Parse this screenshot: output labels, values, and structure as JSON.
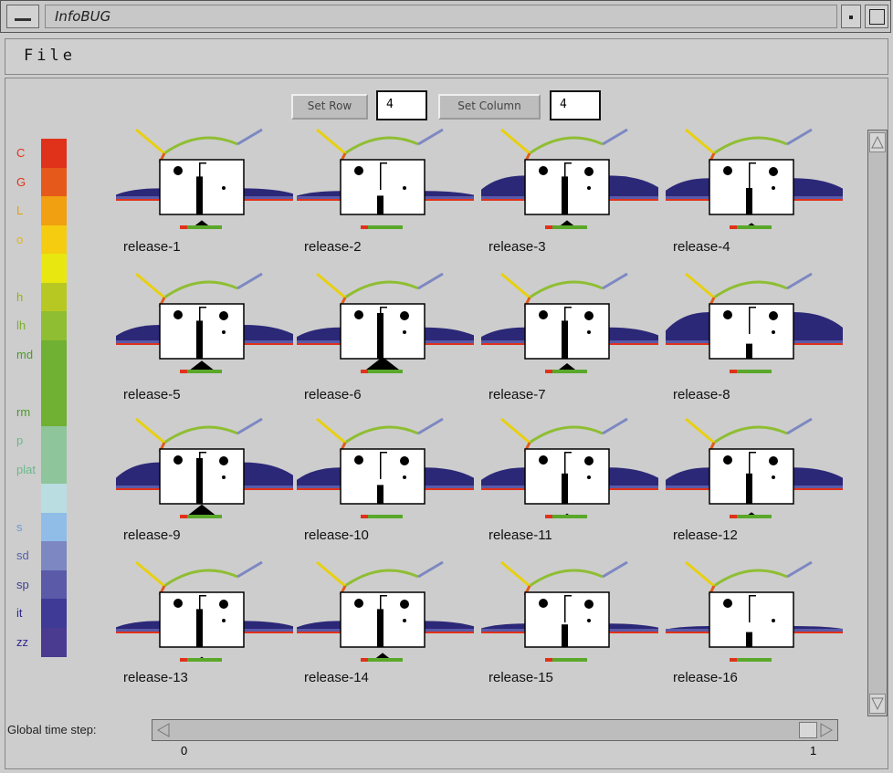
{
  "window": {
    "title": "InfoBUG",
    "menu_icon": "window-menu-icon",
    "minimize_icon": "minimize-icon",
    "maximize_icon": "maximize-icon"
  },
  "menubar": {
    "file_label": "File"
  },
  "controls": {
    "set_row_label": "Set Row",
    "row_value": "4",
    "set_column_label": "Set Column",
    "column_value": "4"
  },
  "legend": {
    "items": [
      {
        "label": "C",
        "color": "#e0321a",
        "label_color": "#e0321a"
      },
      {
        "label": "G",
        "color": "#e5591a",
        "label_color": "#e0321a"
      },
      {
        "label": "L",
        "color": "#f0a010",
        "label_color": "#e6a000"
      },
      {
        "label": "o",
        "color": "#f5cc10",
        "label_color": "#e6b800"
      },
      {
        "label": "",
        "color": "#e8e810",
        "label_color": "#cfcf00"
      },
      {
        "label": "h",
        "color": "#b8c822",
        "label_color": "#9ab000"
      },
      {
        "label": "lh",
        "color": "#8fbe32",
        "label_color": "#7ab02a"
      },
      {
        "label": "md",
        "color": "#70b032",
        "label_color": "#4a9a2a"
      },
      {
        "label": "",
        "color": "#70b032",
        "label_color": "#4a9a2a"
      },
      {
        "label": "rm",
        "color": "#70b032",
        "label_color": "#4a9a2a"
      },
      {
        "label": "p",
        "color": "#8ec59a",
        "label_color": "#6aba8a"
      },
      {
        "label": "plat",
        "color": "#8ec59a",
        "label_color": "#6aba8a"
      },
      {
        "label": "",
        "color": "#b9dde0",
        "label_color": "#8ab"
      },
      {
        "label": "s",
        "color": "#8fbde8",
        "label_color": "#6a9ad8"
      },
      {
        "label": "sd",
        "color": "#7d88c2",
        "label_color": "#5560a8"
      },
      {
        "label": "sp",
        "color": "#5a5aa8",
        "label_color": "#404090"
      },
      {
        "label": "it",
        "color": "#3e3a96",
        "label_color": "#302890"
      },
      {
        "label": "zz",
        "color": "#4a3a90",
        "label_color": "#302890"
      }
    ]
  },
  "glyphs": [
    {
      "label": "release-1",
      "mountain": 0.2,
      "tri": 0.4,
      "nose": 0.8,
      "eyeL": 1,
      "eyeR": 0,
      "ears": 0.3
    },
    {
      "label": "release-2",
      "mountain": 0.1,
      "tri": 0.0,
      "nose": 0.3,
      "eyeL": 1,
      "eyeR": 0,
      "ears": 0.2
    },
    {
      "label": "release-3",
      "mountain": 0.7,
      "tri": 0.4,
      "nose": 0.8,
      "eyeL": 1,
      "eyeR": 1,
      "ears": 0.6
    },
    {
      "label": "release-4",
      "mountain": 0.6,
      "tri": 0.2,
      "nose": 0.5,
      "eyeL": 1,
      "eyeR": 1,
      "ears": 0.5
    },
    {
      "label": "release-5",
      "mountain": 0.5,
      "tri": 0.7,
      "nose": 0.8,
      "eyeL": 1,
      "eyeR": 1,
      "ears": 0.5
    },
    {
      "label": "release-6",
      "mountain": 0.4,
      "tri": 1.0,
      "nose": 1.0,
      "eyeL": 1,
      "eyeR": 1,
      "ears": 0.4
    },
    {
      "label": "release-7",
      "mountain": 0.4,
      "tri": 0.5,
      "nose": 0.8,
      "eyeL": 1,
      "eyeR": 1,
      "ears": 0.5
    },
    {
      "label": "release-8",
      "mountain": 1.0,
      "tri": 0.0,
      "nose": 0.2,
      "eyeL": 1,
      "eyeR": 1,
      "ears": 0.6
    },
    {
      "label": "release-9",
      "mountain": 0.8,
      "tri": 0.8,
      "nose": 1.0,
      "eyeL": 1,
      "eyeR": 1,
      "ears": 0.7
    },
    {
      "label": "release-10",
      "mountain": 0.6,
      "tri": 0.0,
      "nose": 0.3,
      "eyeL": 1,
      "eyeR": 1,
      "ears": 0.5
    },
    {
      "label": "release-11",
      "mountain": 0.6,
      "tri": 0.1,
      "nose": 0.6,
      "eyeL": 1,
      "eyeR": 1,
      "ears": 0.5
    },
    {
      "label": "release-12",
      "mountain": 0.6,
      "tri": 0.2,
      "nose": 0.6,
      "eyeL": 1,
      "eyeR": 1,
      "ears": 0.5
    },
    {
      "label": "release-13",
      "mountain": 0.2,
      "tri": 0.1,
      "nose": 0.8,
      "eyeL": 1,
      "eyeR": 1,
      "ears": 0.4
    },
    {
      "label": "release-14",
      "mountain": 0.2,
      "tri": 0.4,
      "nose": 0.8,
      "eyeL": 1,
      "eyeR": 1,
      "ears": 0.4
    },
    {
      "label": "release-15",
      "mountain": 0.1,
      "tri": 0.0,
      "nose": 0.4,
      "eyeL": 1,
      "eyeR": 1,
      "ears": 0.4
    },
    {
      "label": "release-16",
      "mountain": 0.0,
      "tri": 0.0,
      "nose": 0.2,
      "eyeL": 1,
      "eyeR": 0,
      "ears": 0.3
    }
  ],
  "time": {
    "label": "Global time step:",
    "min_label": "0",
    "max_label": "1",
    "value": 1.0
  }
}
